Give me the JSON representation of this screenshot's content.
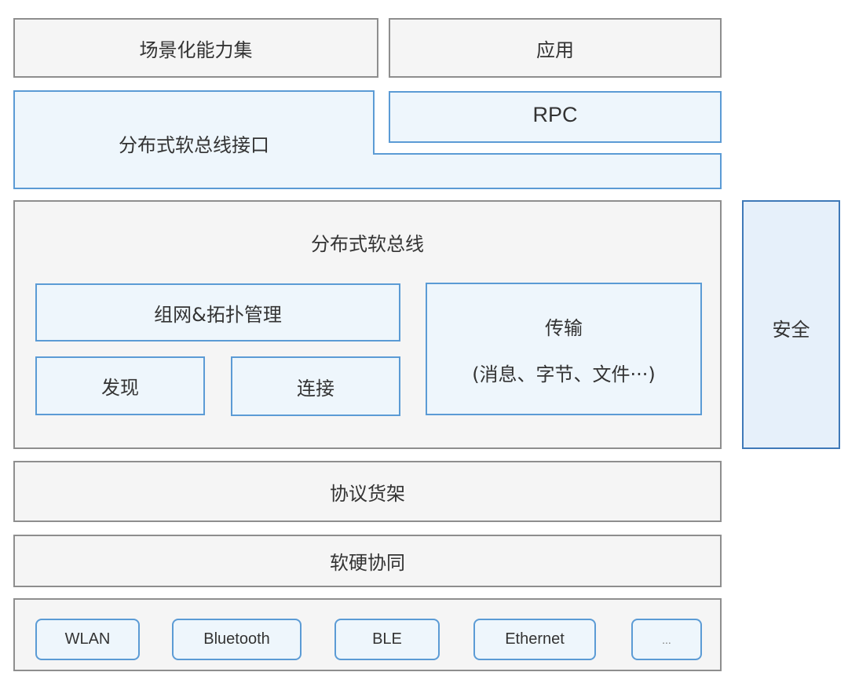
{
  "diagram": {
    "top_row": {
      "scenario_capabilities": "场景化能力集",
      "application": "应用"
    },
    "interface_layer": {
      "softbus_interface": "分布式软总线接口",
      "rpc": "RPC"
    },
    "softbus": {
      "title": "分布式软总线",
      "networking_topology": "组网&拓扑管理",
      "discovery": "发现",
      "connection": "连接",
      "transmission": "传输",
      "transmission_detail": "(消息、字节、文件···)"
    },
    "security": "安全",
    "protocol_shelf": "协议货架",
    "hw_sw_collab": "软硬协同",
    "transports": [
      "WLAN",
      "Bluetooth",
      "BLE",
      "Ethernet",
      "..."
    ]
  }
}
